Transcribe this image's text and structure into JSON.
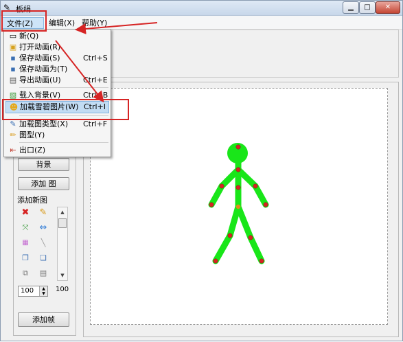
{
  "window": {
    "title": "板绢"
  },
  "menubar": {
    "items": [
      {
        "label": "文件(Z)"
      },
      {
        "label": "编辑(X)"
      },
      {
        "label": "帮助(Y)"
      }
    ]
  },
  "file_menu": {
    "items": [
      {
        "label": "新(Q)",
        "shortcut": ""
      },
      {
        "label": "打开动画(R)",
        "shortcut": ""
      },
      {
        "label": "保存动画(S)",
        "shortcut": "Ctrl+S"
      },
      {
        "label": "保存动画为(T)",
        "shortcut": ""
      },
      {
        "label": "导出动画(U)",
        "shortcut": "Ctrl+E"
      },
      {
        "label": "载入背景(V)",
        "shortcut": "Ctrl+B"
      },
      {
        "label": "加载雪碧图片(W)",
        "shortcut": "Ctrl+I"
      },
      {
        "label": "加载图类型(X)",
        "shortcut": "Ctrl+F"
      },
      {
        "label": "图型(Y)",
        "shortcut": ""
      },
      {
        "label": "出口(Z)",
        "shortcut": ""
      }
    ]
  },
  "left_panel": {
    "background_button": "背景",
    "add_figure_button": "添加 图",
    "add_new_figure_label": "添加新图",
    "spin_value": "100",
    "spin_max_label": "100",
    "add_frame_button": "添加帧"
  },
  "colors": {
    "figure": "#19e619",
    "joint": "#d62424",
    "highlight_box": "#d62424"
  }
}
